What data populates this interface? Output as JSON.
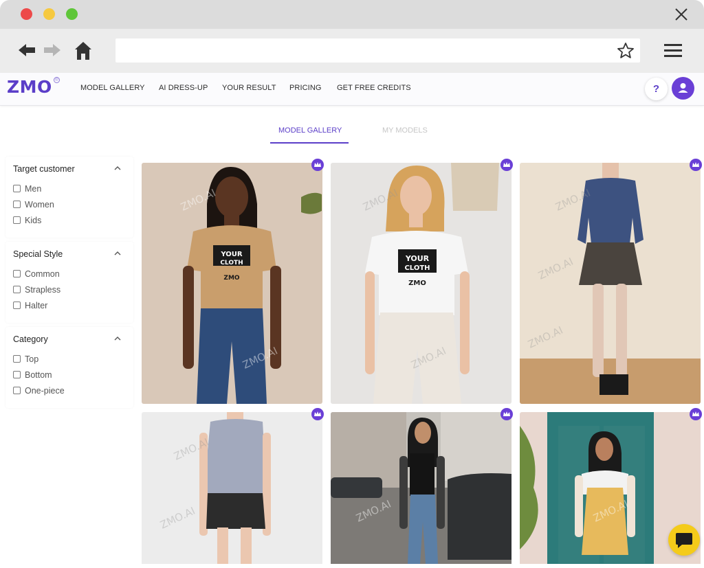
{
  "app": {
    "logo_text": "ZMO",
    "logo_mark": "®"
  },
  "nav": {
    "items": [
      {
        "label": "MODEL GALLERY"
      },
      {
        "label": "AI DRESS-UP"
      },
      {
        "label": "YOUR RESULT"
      },
      {
        "label": "PRICING"
      },
      {
        "label": "GET FREE CREDITS"
      }
    ],
    "help_label": "?"
  },
  "tabs": [
    {
      "label": "MODEL GALLERY",
      "active": true
    },
    {
      "label": "MY MODELS",
      "active": false
    }
  ],
  "filters": [
    {
      "title": "Target customer",
      "options": [
        "Men",
        "Women",
        "Kids"
      ]
    },
    {
      "title": "Special Style",
      "options": [
        "Common",
        "Strapless",
        "Halter"
      ]
    },
    {
      "title": "Category",
      "options": [
        "Top",
        "Bottom",
        "One-piece"
      ]
    }
  ],
  "gallery": {
    "watermark": "ZMO.AI",
    "shirt_print": [
      "YOUR",
      "CLOTH",
      "ZMO"
    ]
  },
  "colors": {
    "brand": "#5b3ec8",
    "badge": "#6a3fd6",
    "chat": "#f4cb1a"
  }
}
